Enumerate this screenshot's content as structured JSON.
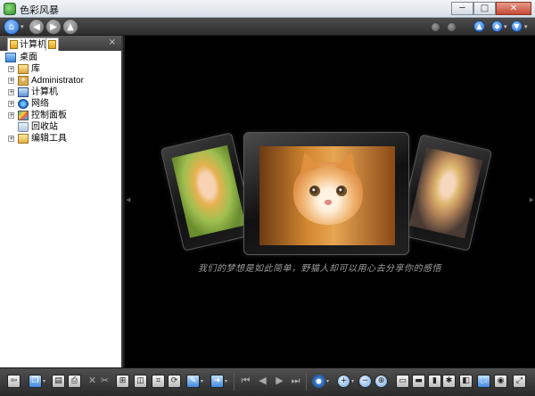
{
  "window": {
    "title": "色彩风暴",
    "min_glyph": "─",
    "max_glyph": "□",
    "close_glyph": "✕"
  },
  "top_toolbar": {
    "home_glyph": "⌂",
    "back_glyph": "◀",
    "forward_glyph": "▶",
    "up_glyph": "▲",
    "caret": "▾",
    "right_buttons": [
      "▲",
      "◆",
      "▼"
    ]
  },
  "sidebar": {
    "tabs": [
      {
        "label": "计算机"
      }
    ],
    "close_glyph": "×",
    "tree": [
      {
        "label": "桌面",
        "icon": "desktop-icon"
      },
      {
        "label": "库",
        "icon": "library-icon",
        "expander": "+"
      },
      {
        "label": "Administrator",
        "icon": "user-folder-icon",
        "expander": "+"
      },
      {
        "label": "计算机",
        "icon": "computer-icon",
        "expander": "+"
      },
      {
        "label": "网络",
        "icon": "network-icon",
        "expander": "+"
      },
      {
        "label": "控制面板",
        "icon": "control-panel-icon",
        "expander": "+"
      },
      {
        "label": "回收站",
        "icon": "recycle-bin-icon"
      },
      {
        "label": "编辑工具",
        "icon": "folder-icon",
        "expander": "+"
      }
    ]
  },
  "viewer": {
    "background": "#000000",
    "caption": "我们的梦想是如此简单，野猫人却可以用心去分享你的感悟",
    "edge_left": "◀",
    "edge_right": "▶"
  },
  "bottom_toolbar": {
    "glyphs": {
      "back": "⇦",
      "copy": "❐",
      "save": "▤",
      "print": "⎙",
      "cut": "✂",
      "delete": "✕",
      "fit": "⊞",
      "compare": "◫",
      "crop": "⌗",
      "rotate": "⟳",
      "edit": "✎",
      "send": "➜",
      "first": "⏮",
      "prev": "◀",
      "next": "▶",
      "last": "⏭",
      "settings": "⚙",
      "zoom_in": "+",
      "zoom_out": "−",
      "zoom_fit": "⊕",
      "view1": "▭",
      "view2": "▬",
      "view3": "▮",
      "tools": "✱",
      "layout": "◧",
      "fullscreen": "⛶",
      "info": "◉",
      "exit": "⤢",
      "caret": "▾"
    }
  }
}
